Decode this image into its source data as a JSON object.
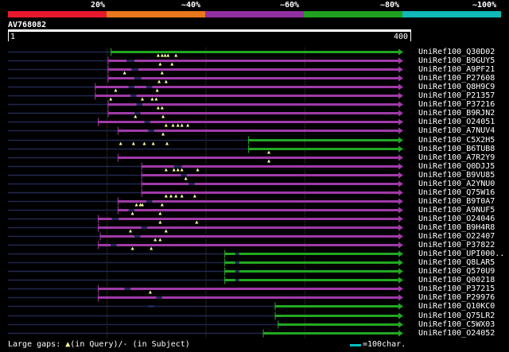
{
  "legend": {
    "colors": [
      "#e8182c",
      "#e8781c",
      "#9030a0",
      "#20a020",
      "#10b8b8"
    ],
    "labels": [
      "20%",
      "~40%",
      "~60%",
      "~80%",
      "~100%"
    ]
  },
  "query": {
    "id": "AV768082",
    "start": "1",
    "end": "400",
    "length": 400
  },
  "colors": {
    "bg": "#000000",
    "query_line": "#202850",
    "purple": "#a03aa8",
    "green": "#22a822",
    "grid": "#404040",
    "gap_marker": "#ffffa0",
    "scale_key": "#00c0c0"
  },
  "rows": [
    {
      "name": "UniRef100_Q30D02",
      "color": "green",
      "start": 104,
      "end": 400,
      "subject_gaps": [],
      "query_gaps": [
        152,
        156,
        159,
        162,
        170
      ]
    },
    {
      "name": "UniRef100_B9GUY5",
      "color": "purple",
      "start": 101,
      "end": 400,
      "subject_gaps": [
        [
          120,
          128
        ]
      ],
      "query_gaps": [
        154,
        166
      ]
    },
    {
      "name": "UniRef100_A9PF21",
      "color": "purple",
      "start": 101,
      "end": 400,
      "subject_gaps": [
        [
          125,
          132
        ]
      ],
      "query_gaps": [
        118,
        156
      ]
    },
    {
      "name": "UniRef100_P27608",
      "color": "purple",
      "start": 101,
      "end": 400,
      "subject_gaps": [
        [
          128,
          135
        ]
      ],
      "query_gaps": [
        153,
        160
      ]
    },
    {
      "name": "UniRef100_Q8H9C9",
      "color": "purple",
      "start": 88,
      "end": 400,
      "subject_gaps": [
        [
          122,
          128
        ],
        [
          140,
          146
        ]
      ],
      "query_gaps": [
        109,
        151
      ]
    },
    {
      "name": "UniRef100_P21357",
      "color": "purple",
      "start": 88,
      "end": 400,
      "subject_gaps": [
        [
          124,
          130
        ]
      ],
      "query_gaps": [
        104,
        136,
        146,
        150
      ]
    },
    {
      "name": "UniRef100_P37216",
      "color": "purple",
      "start": 101,
      "end": 400,
      "subject_gaps": [
        [
          130,
          136
        ]
      ],
      "query_gaps": [
        152,
        156
      ]
    },
    {
      "name": "UniRef100_B9RJN2",
      "color": "purple",
      "start": 101,
      "end": 400,
      "subject_gaps": [
        [
          128,
          134
        ]
      ],
      "query_gaps": [
        129,
        157
      ]
    },
    {
      "name": "UniRef100_O24051",
      "color": "purple",
      "start": 91,
      "end": 400,
      "subject_gaps": [
        [
          138,
          144
        ]
      ],
      "query_gaps": [
        160,
        167,
        172,
        176,
        182
      ]
    },
    {
      "name": "UniRef100_A7NUV4",
      "color": "purple",
      "start": 111,
      "end": 400,
      "subject_gaps": [
        [
          142,
          148
        ]
      ],
      "query_gaps": [
        157
      ]
    },
    {
      "name": "UniRef100_C5X2H5",
      "color": "green",
      "start": 243,
      "end": 400,
      "subject_gaps": [],
      "query_gaps": [
        114,
        127,
        138,
        147,
        161
      ]
    },
    {
      "name": "UniRef100_B6TUB8",
      "color": "green",
      "start": 243,
      "end": 400,
      "subject_gaps": [],
      "query_gaps": [
        264
      ]
    },
    {
      "name": "UniRef100_A7R2Y9",
      "color": "purple",
      "start": 111,
      "end": 400,
      "subject_gaps": [],
      "query_gaps": [
        264
      ]
    },
    {
      "name": "UniRef100_Q0DJJ5",
      "color": "purple",
      "start": 135,
      "end": 400,
      "subject_gaps": [
        [
          168,
          176
        ]
      ],
      "query_gaps": [
        160,
        168,
        172,
        176,
        192
      ]
    },
    {
      "name": "UniRef100_B9VU85",
      "color": "purple",
      "start": 135,
      "end": 400,
      "subject_gaps": [
        [
          175,
          181
        ]
      ],
      "query_gaps": [
        180
      ]
    },
    {
      "name": "UniRef100_A2YNU0",
      "color": "purple",
      "start": 135,
      "end": 400,
      "subject_gaps": [
        [
          183,
          189
        ]
      ],
      "query_gaps": []
    },
    {
      "name": "UniRef100_Q75W16",
      "color": "purple",
      "start": 135,
      "end": 400,
      "subject_gaps": [],
      "query_gaps": [
        160,
        165,
        170,
        176,
        189
      ]
    },
    {
      "name": "UniRef100_B9T0A7",
      "color": "purple",
      "start": 111,
      "end": 400,
      "subject_gaps": [
        [
          140,
          146
        ]
      ],
      "query_gaps": [
        130,
        134,
        136,
        156
      ]
    },
    {
      "name": "UniRef100_A9NUF5",
      "color": "purple",
      "start": 111,
      "end": 400,
      "subject_gaps": [
        [
          122,
          128
        ]
      ],
      "query_gaps": [
        126,
        154
      ]
    },
    {
      "name": "UniRef100_O24046",
      "color": "purple",
      "start": 91,
      "end": 400,
      "subject_gaps": [
        [
          105,
          112
        ]
      ],
      "query_gaps": [
        154,
        191
      ]
    },
    {
      "name": "UniRef100_B9H4R8",
      "color": "purple",
      "start": 91,
      "end": 400,
      "subject_gaps": [
        [
          135,
          141
        ]
      ],
      "query_gaps": [
        124,
        160
      ]
    },
    {
      "name": "UniRef100_O22407",
      "color": "purple",
      "start": 93,
      "end": 400,
      "subject_gaps": [
        [
          128,
          134
        ]
      ],
      "query_gaps": [
        149,
        154
      ]
    },
    {
      "name": "UniRef100_P37822",
      "color": "purple",
      "start": 91,
      "end": 400,
      "subject_gaps": [
        [
          104,
          110
        ]
      ],
      "query_gaps": [
        126,
        145
      ]
    },
    {
      "name": "UniRef100_UPI000..",
      "color": "green",
      "start": 219,
      "end": 400,
      "subject_gaps": [
        [
          230,
          234
        ]
      ],
      "query_gaps": []
    },
    {
      "name": "UniRef100_Q8LAR5",
      "color": "green",
      "start": 219,
      "end": 400,
      "subject_gaps": [
        [
          230,
          234
        ]
      ],
      "query_gaps": []
    },
    {
      "name": "UniRef100_Q570U9",
      "color": "green",
      "start": 219,
      "end": 400,
      "subject_gaps": [
        [
          230,
          234
        ]
      ],
      "query_gaps": []
    },
    {
      "name": "UniRef100_Q00218",
      "color": "green",
      "start": 219,
      "end": 400,
      "subject_gaps": [
        [
          230,
          234
        ]
      ],
      "query_gaps": []
    },
    {
      "name": "UniRef100_P37215",
      "color": "purple",
      "start": 91,
      "end": 400,
      "subject_gaps": [
        [
          118,
          124
        ]
      ],
      "query_gaps": [
        144
      ]
    },
    {
      "name": "UniRef100_P29976",
      "color": "purple",
      "start": 91,
      "end": 400,
      "subject_gaps": [
        [
          150,
          156
        ]
      ],
      "query_gaps": []
    },
    {
      "name": "UniRef100_Q10KC0",
      "color": "green",
      "start": 270,
      "end": 400,
      "subject_gaps": [
        [
          142,
          148
        ]
      ],
      "query_gaps": []
    },
    {
      "name": "UniRef100_Q75LR2",
      "color": "green",
      "start": 270,
      "end": 400,
      "subject_gaps": [],
      "query_gaps": []
    },
    {
      "name": "UniRef100_C5WX03",
      "color": "green",
      "start": 273,
      "end": 400,
      "subject_gaps": [],
      "query_gaps": []
    },
    {
      "name": "UniRef100_O24052",
      "color": "green",
      "start": 258,
      "end": 400,
      "subject_gaps": [],
      "query_gaps": []
    }
  ],
  "footer": {
    "gaps_prefix": "Large gaps: ",
    "gaps_glyph": "▲",
    "gaps_suffix": "(in Query)/- (in Subject)",
    "scale_label": "=100char."
  }
}
